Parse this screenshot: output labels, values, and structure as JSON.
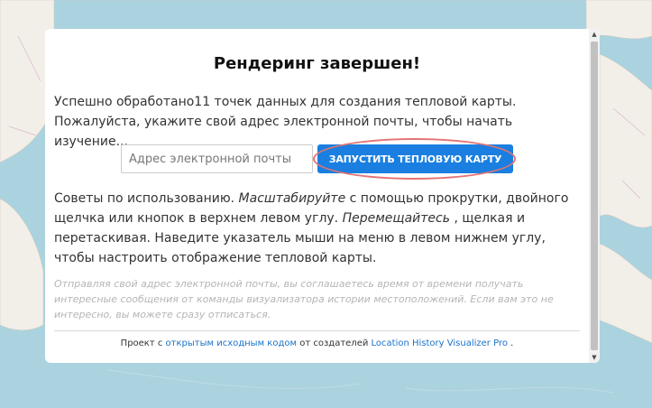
{
  "modal": {
    "title": "Рендеринг завершен!",
    "intro": "Успешно обработано11 точек данных для создания тепловой карты. Пожалуйста, укажите свой адрес электронной почты, чтобы начать изучение...",
    "email_placeholder": "Адрес электронной почты",
    "start_button_label": "ЗАПУСТИТЬ ТЕПЛОВУЮ КАРТУ",
    "tips": {
      "prefix": "Советы по использованию. ",
      "zoom_word": "Масштабируйте",
      "zoom_text": " с помощью прокрутки, двойного щелчка или кнопок в верхнем левом углу. ",
      "pan_word": "Перемещайтесь",
      "pan_text": " , щелкая и перетаскивая. Наведите указатель мыши на меню в левом нижнем углу, чтобы настроить отображение тепловой карты."
    },
    "consent": "Отправляя свой адрес электронной почты, вы соглашаетесь время от времени получать интересные сообщения от команды визуализатора истории местоположений. Если вам это не интересно, вы можете сразу отписаться.",
    "footer": {
      "prefix": "Проект с ",
      "open_source_link": "открытым исходным кодом",
      "middle": " от создателей ",
      "product_link": "Location History Visualizer Pro",
      "suffix": " ."
    }
  },
  "colors": {
    "map_water": "#aad3df",
    "map_land": "#f2efe9",
    "button": "#1a7fe0",
    "highlight_ring": "#e57373",
    "link": "#1a73c8"
  }
}
